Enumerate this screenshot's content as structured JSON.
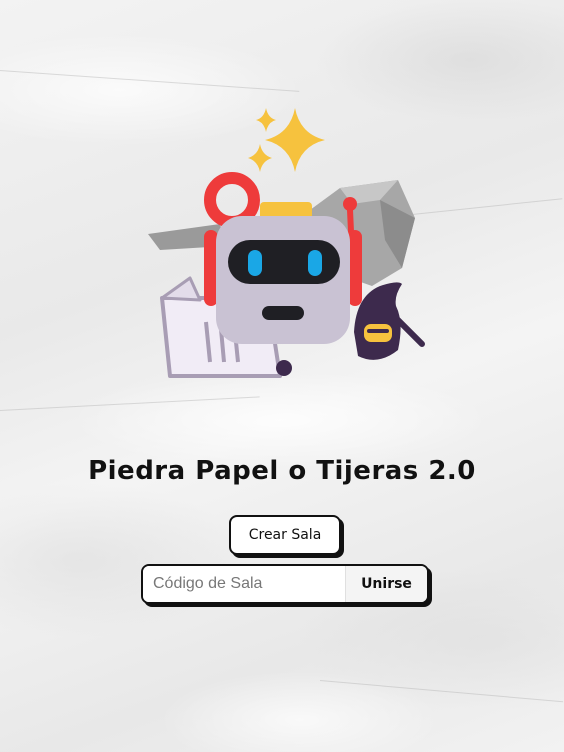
{
  "app": {
    "title": "Piedra Papel o Tijeras 2.0"
  },
  "hero": {
    "icon": "robot-with-rock-paper-scissors-illustration"
  },
  "actions": {
    "create_label": "Crear Sala",
    "join_label": "Unirse"
  },
  "join": {
    "placeholder": "Código de Sala",
    "value": ""
  },
  "colors": {
    "robot_head": "#c9c2d3",
    "robot_visor": "#1f1f24",
    "robot_eyes": "#1aa7e6",
    "antenna_red": "#ee3b3b",
    "star_yellow": "#f6c23e",
    "rock_gray": "#a7a7a7",
    "ninja_purple": "#3d2a4d"
  }
}
